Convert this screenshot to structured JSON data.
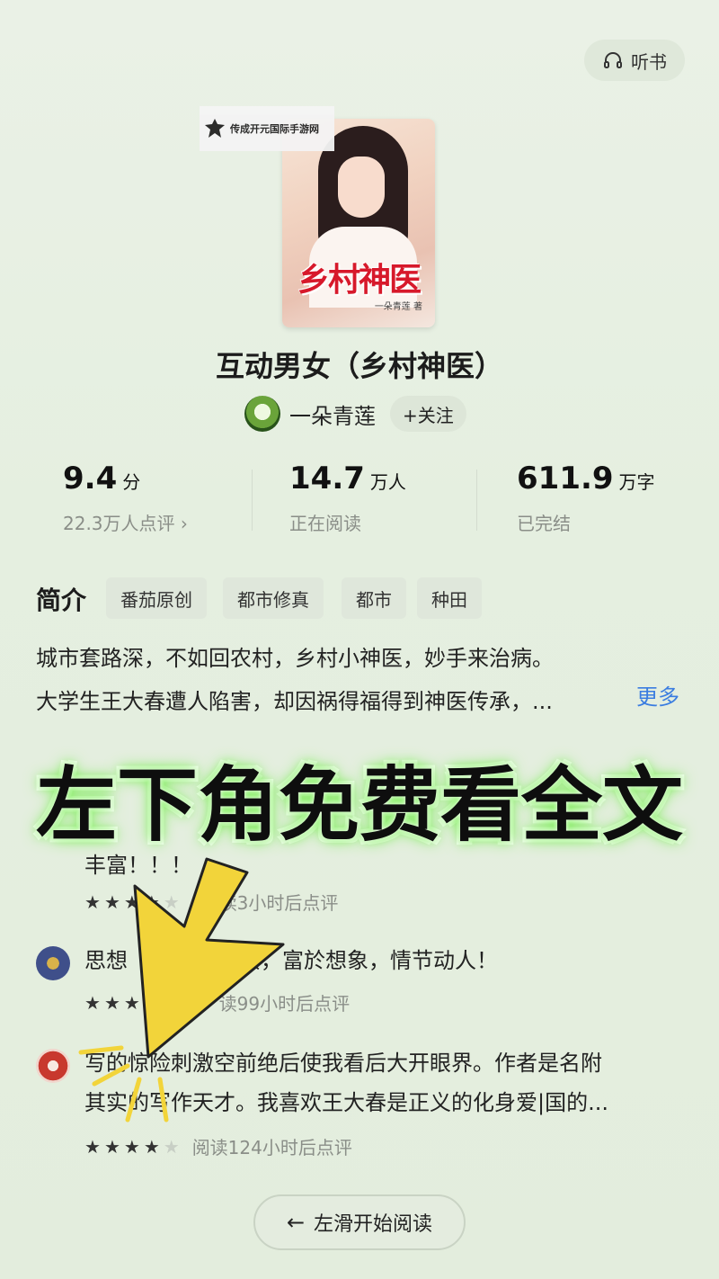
{
  "header": {
    "listen_label": "听书",
    "listen_icon": "headphones-icon"
  },
  "watermark": {
    "text": "传成开元国际手游网"
  },
  "cover": {
    "title": "乡村神医",
    "author": "一朵青莲 著"
  },
  "book": {
    "title": "互动男女（乡村神医）"
  },
  "author": {
    "name": "一朵青莲",
    "follow_label": "+关注"
  },
  "stats": [
    {
      "value": "9.4",
      "unit": "分",
      "sub": "22.3万人点评 ›"
    },
    {
      "value": "14.7",
      "unit": "万人",
      "sub": "正在阅读"
    },
    {
      "value": "611.9",
      "unit": "万字",
      "sub": "已完结"
    }
  ],
  "intro": {
    "heading": "简介",
    "tags": [
      "番茄原创",
      "都市修真",
      "都市",
      "种田"
    ],
    "line1": "城市套路深，不如回农村，乡村小神医，妙手来治病。",
    "line2": "大学生王大春遭人陷害，却因祸得福得到神医传承，...",
    "more_label": "更多"
  },
  "reviews": [
    {
      "text_partial": "丰富！！！",
      "meta": "读3小时后点评",
      "stars": 4
    },
    {
      "text_a": "思想",
      "text_b": "现实，富於想象，情节动人！",
      "meta": "读99小时后点评",
      "stars": 4
    },
    {
      "text_line1": "写的惊险刺激空前绝后使我看后大开眼界。作者是名附",
      "text_line2": "其实的写作天才。我喜欢王大春是正义的化身爱|国的...",
      "meta": "阅读124小时后点评",
      "stars": 4
    }
  ],
  "overlay": {
    "text": "左下角免费看全文",
    "arrow_color": "#f2d43a",
    "glow_color": "#6aea3f"
  },
  "footer": {
    "read_label": "左滑开始阅读",
    "arrow_icon": "arrow-left-icon"
  },
  "colors": {
    "accent_link": "#3b7de0",
    "background": "#e5efe0"
  }
}
